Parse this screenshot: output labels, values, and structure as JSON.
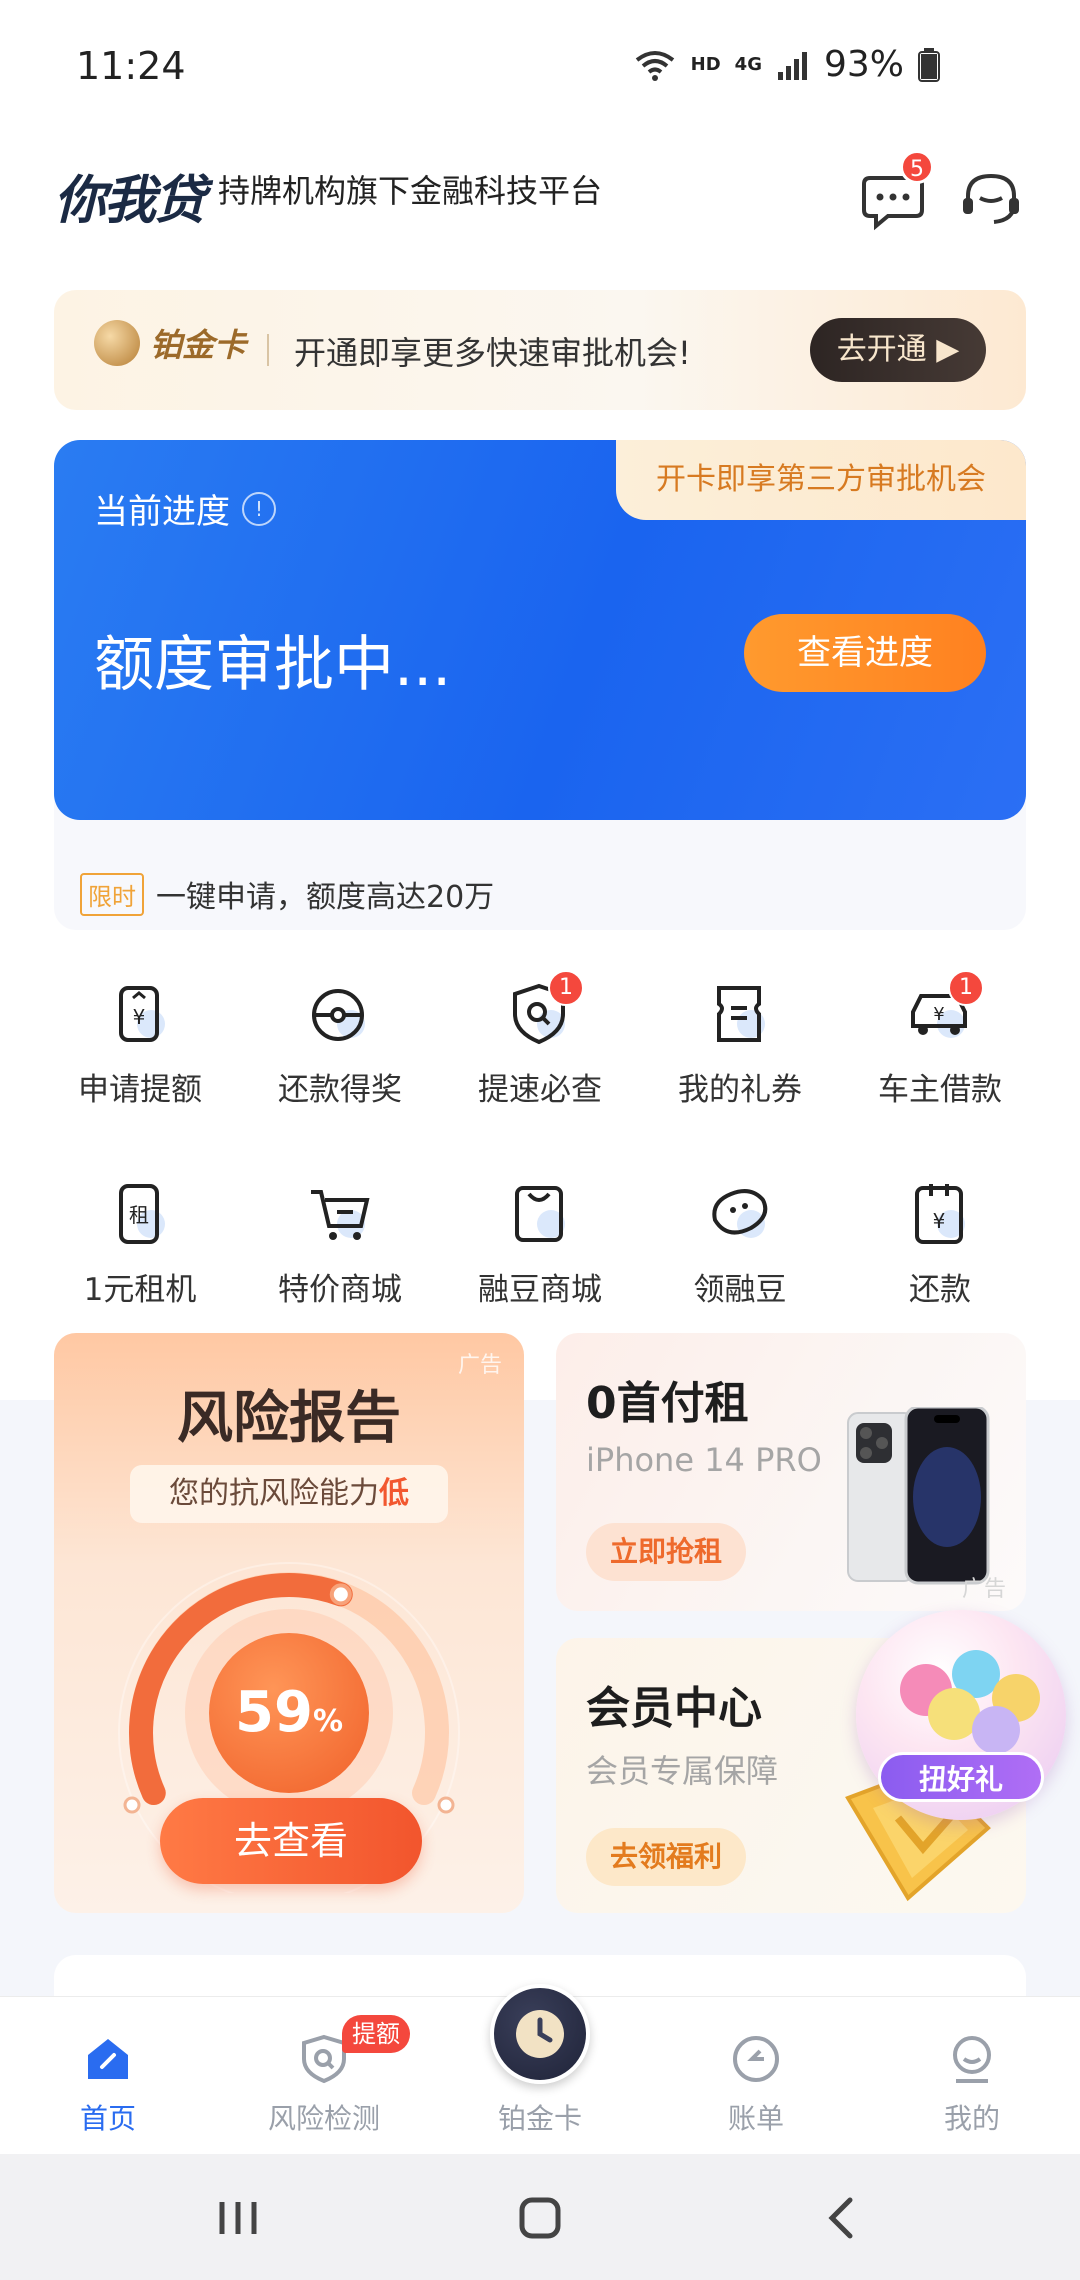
{
  "status_bar": {
    "time": "11:24",
    "network_hd": "HD",
    "network_4g": "4G",
    "battery": "93%"
  },
  "header": {
    "brand": "你我贷",
    "tagline": "持牌机构旗下金融科技平台",
    "message_badge": "5"
  },
  "platinum_banner": {
    "name": "铂金卡",
    "text": "开通即享更多快速审批机会!",
    "button": "去开通"
  },
  "progress_card": {
    "tag": "开卡即享第三方审批机会",
    "label": "当前进度",
    "status": "额度审批中...",
    "button": "查看进度"
  },
  "limited_offer": {
    "tag": "限时",
    "text": "一键申请，额度高达20万"
  },
  "quick_actions": [
    {
      "label": "申请提额",
      "icon": "phone-up-yen-icon",
      "badge": ""
    },
    {
      "label": "还款得奖",
      "icon": "pokeball-icon",
      "badge": ""
    },
    {
      "label": "提速必查",
      "icon": "shield-search-icon",
      "badge": "1"
    },
    {
      "label": "我的礼券",
      "icon": "coupon-icon",
      "badge": ""
    },
    {
      "label": "车主借款",
      "icon": "car-yen-icon",
      "badge": "1"
    },
    {
      "label": "1元租机",
      "icon": "phone-rent-icon",
      "badge": ""
    },
    {
      "label": "特价商城",
      "icon": "cart-icon",
      "badge": ""
    },
    {
      "label": "融豆商城",
      "icon": "bag-icon",
      "badge": ""
    },
    {
      "label": "领融豆",
      "icon": "bean-icon",
      "badge": ""
    },
    {
      "label": "还款",
      "icon": "repay-icon",
      "badge": ""
    }
  ],
  "risk_card": {
    "ad": "广告",
    "title": "风险报告",
    "subtitle_prefix": "您的抗风险能力",
    "subtitle_level": "低",
    "score": "59",
    "score_unit": "%",
    "score_fraction": 0.59,
    "button": "去查看"
  },
  "rent_card": {
    "title": "0首付租",
    "subtitle": "iPhone 14 PRO",
    "button": "立即抢租",
    "ad": "广告"
  },
  "member_card": {
    "title": "会员中心",
    "subtitle": "会员专属保障",
    "button": "去领福利",
    "gacha_label": "扭好礼"
  },
  "tabbar": {
    "tabs": [
      {
        "label": "首页",
        "icon": "home-icon",
        "active": true
      },
      {
        "label": "风险检测",
        "icon": "shield-check-icon",
        "badge": "提额"
      },
      {
        "label": "铂金卡",
        "icon": "clock-icon"
      },
      {
        "label": "账单",
        "icon": "bill-icon"
      },
      {
        "label": "我的",
        "icon": "profile-icon"
      }
    ]
  },
  "colors": {
    "primary_blue": "#1a64ef",
    "accent_orange": "#ff8120",
    "badge_red": "#f4483d"
  }
}
